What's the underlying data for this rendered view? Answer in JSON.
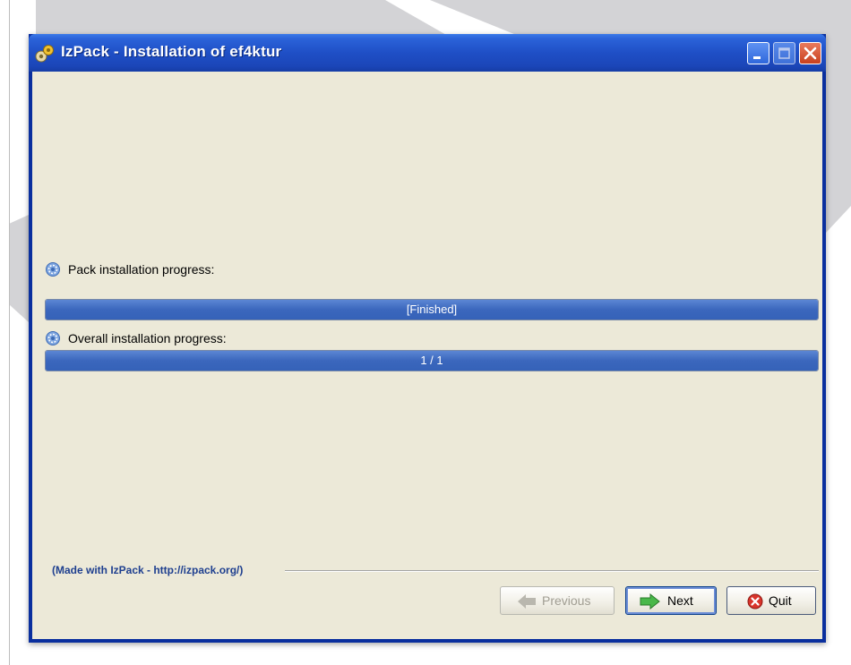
{
  "window": {
    "title": "IzPack - Installation of ef4ktur"
  },
  "pack_progress": {
    "label": "Pack installation progress:",
    "status_text": "[Finished]",
    "fraction": 1.0
  },
  "overall_progress": {
    "label": "Overall installation progress:",
    "status_text": "1 / 1",
    "fraction": 1.0
  },
  "footer": {
    "credit": "(Made with IzPack - http://izpack.org/)"
  },
  "buttons": {
    "previous": "Previous",
    "next": "Next",
    "quit": "Quit"
  },
  "colors": {
    "title_bar": "#1f4fc6",
    "progress_fill": "#3b67bd",
    "client_bg": "#ece9d8"
  }
}
